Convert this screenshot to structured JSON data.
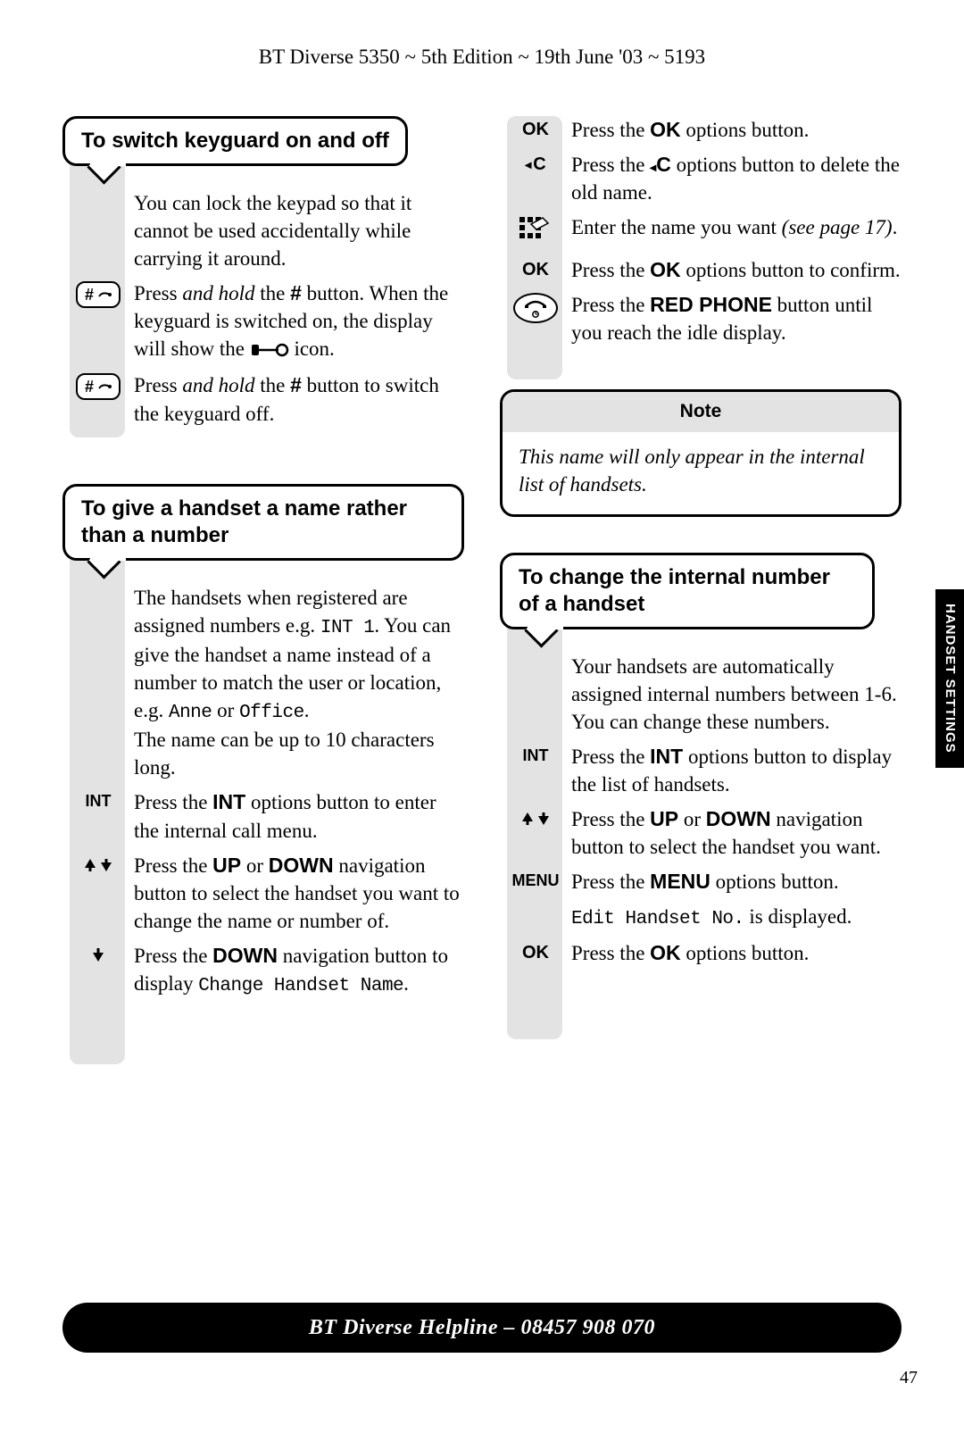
{
  "header": "BT Diverse 5350 ~ 5th Edition ~ 19th June '03 ~ 5193",
  "side_tab": "HANDSET SETTINGS",
  "footer": "BT Diverse Helpline – 08457 908 070",
  "page_number": "47",
  "sec1": {
    "title": "To switch keyguard on and off",
    "intro": "You can lock the keypad so that it cannot be used accidentally while carrying it around.",
    "p1a": "Press ",
    "p1b": "and hold",
    "p1c": " the ",
    "p1d": "#",
    "p1e": " button. When the keyguard is switched on, the display will show the ",
    "p1f": " icon.",
    "p2a": "Press ",
    "p2b": "and hold",
    "p2c": " the ",
    "p2d": "#",
    "p2e": " button to switch the keyguard off."
  },
  "sec2": {
    "title": "To give a handset a name rather than a number",
    "i1": "The handsets when registered are assigned numbers e.g. ",
    "i1b": "INT 1",
    "i1c": ". You can give the handset a name instead of a number to match the user or location, e.g. ",
    "i1d": "Anne",
    "i1e": " or ",
    "i1f": "Office",
    "i1g": ".",
    "i2": "The name can be up to 10 characters long.",
    "s1a": "Press the ",
    "s1b": "INT",
    "s1c": " options button to enter the internal call menu.",
    "s2a": "Press the ",
    "s2b": "UP",
    "s2c": " or ",
    "s2d": "DOWN",
    "s2e": " navigation button to select the handset you want to change the name or number of.",
    "s3a": "Press the ",
    "s3b": "DOWN",
    "s3c": " navigation button to display ",
    "s3d": "Change Handset Name",
    "s3e": "."
  },
  "right_steps": {
    "s1a": "Press the ",
    "s1b": "OK",
    "s1c": " options button.",
    "s2a": "Press the ",
    "s2c": " options button to delete the old name.",
    "s2b": "C",
    "s3a": "Enter the name you want ",
    "s3b": "(see page 17)",
    "s3c": ".",
    "s4a": "Press the ",
    "s4b": "OK",
    "s4c": " options button to confirm.",
    "s5a": "Press the ",
    "s5b": "RED PHONE",
    "s5c": " button until you reach the idle display."
  },
  "note": {
    "title": "Note",
    "body": "This name will only appear in the internal list of handsets."
  },
  "sec3": {
    "title": "To change the internal number of a handset",
    "intro": "Your handsets are automatically assigned internal numbers between 1-6. You can change these numbers.",
    "s1a": "Press the ",
    "s1b": "INT",
    "s1c": " options button to display the list of handsets.",
    "s2a": "Press the ",
    "s2b": "UP",
    "s2c": " or ",
    "s2d": "DOWN",
    "s2e": " navigation button to select the handset you want.",
    "s3a": "Press the ",
    "s3b": "MENU",
    "s3c": " options button.",
    "s4": "Edit Handset No.",
    "s4b": " is displayed.",
    "s5a": "Press the ",
    "s5b": "OK",
    "s5c": " options button."
  },
  "icons": {
    "ok": "OK",
    "c": "C",
    "int": "INT",
    "menu": "MENU",
    "hash": "#"
  }
}
